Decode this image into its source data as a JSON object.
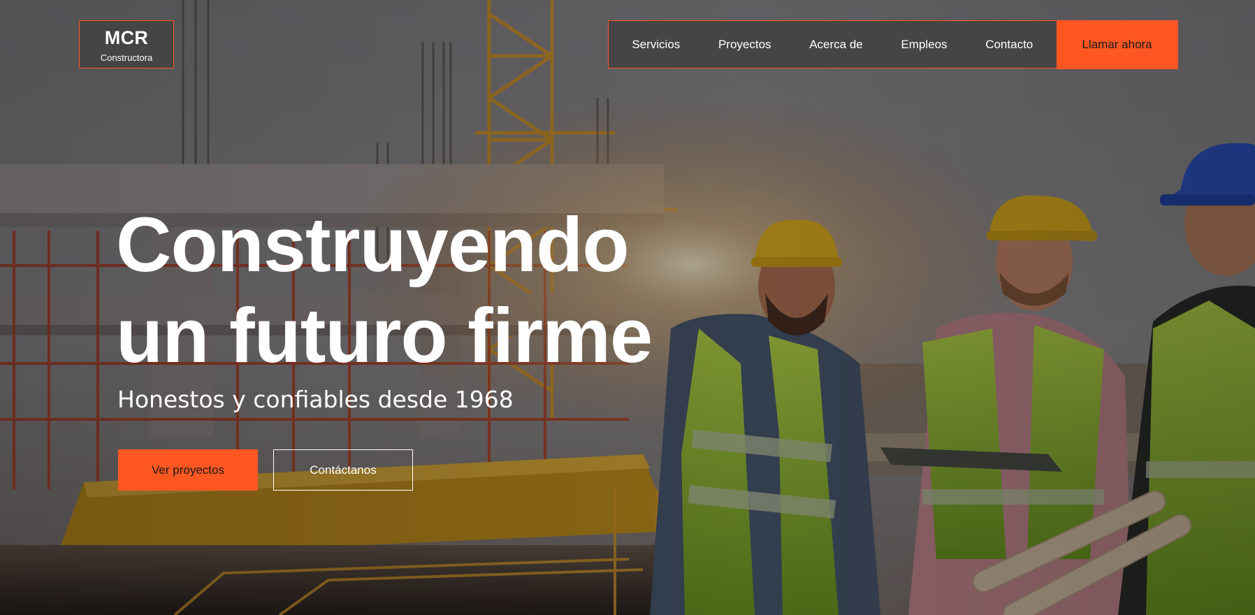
{
  "brand": {
    "name": "MCR",
    "tagline": "Constructora"
  },
  "nav": {
    "items": [
      {
        "label": "Servicios"
      },
      {
        "label": "Proyectos"
      },
      {
        "label": "Acerca de"
      },
      {
        "label": "Empleos"
      },
      {
        "label": "Contacto"
      }
    ],
    "cta_label": "Llamar ahora"
  },
  "hero": {
    "headline_line1": "Construyendo",
    "headline_line2": "un futuro firme",
    "subtitle": "Honestos y confiables desde 1968",
    "primary_button": "Ver proyectos",
    "secondary_button": "Contáctanos",
    "background_image": "construction-site-workers-photo"
  },
  "colors": {
    "accent": "#ff5722",
    "panel": "#454545",
    "text": "#ffffff",
    "button_text": "#1a1a1a"
  }
}
